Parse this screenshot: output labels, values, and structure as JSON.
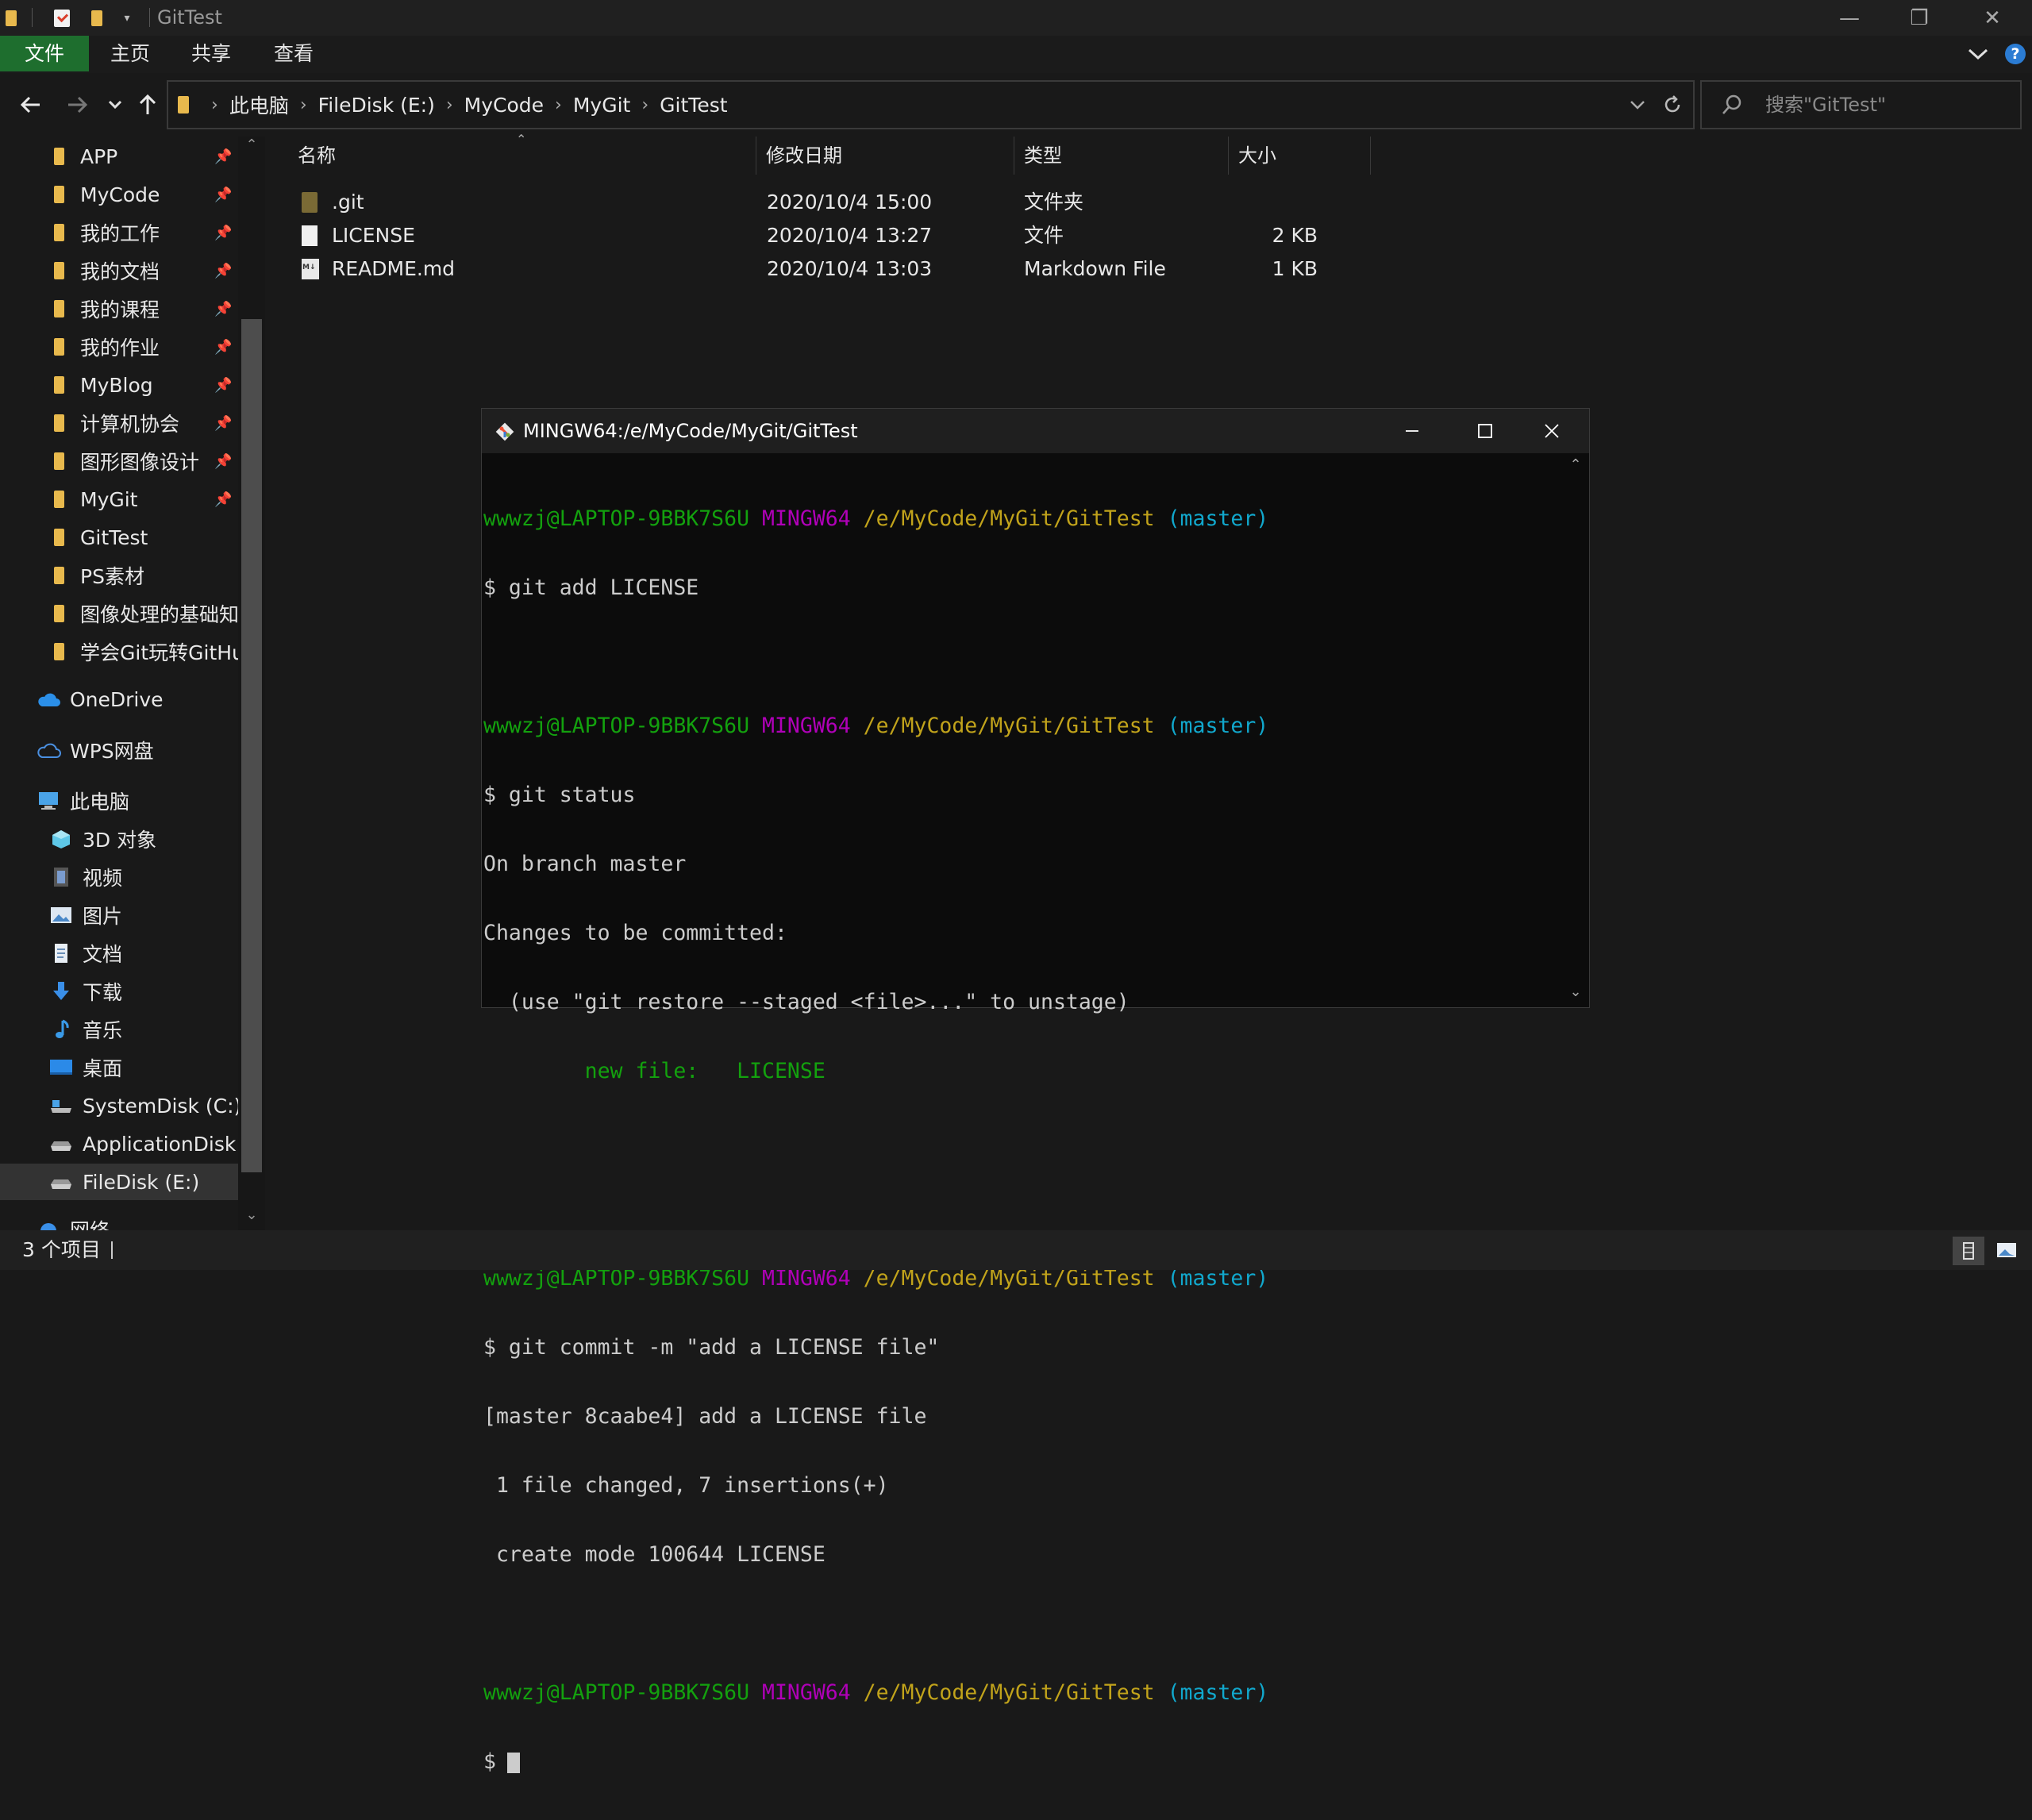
{
  "window": {
    "title": "GitTest",
    "controls": {
      "minimize": "—",
      "maximize": "❐",
      "close": "✕"
    }
  },
  "ribbon": {
    "tabs": [
      "文件",
      "主页",
      "共享",
      "查看"
    ],
    "help": "?"
  },
  "address": {
    "crumbs": [
      "此电脑",
      "FileDisk (E:)",
      "MyCode",
      "MyGit",
      "GitTest"
    ],
    "search_placeholder": "搜索\"GitTest\""
  },
  "nav": {
    "quick_access": [
      {
        "label": "APP",
        "pinned": true
      },
      {
        "label": "MyCode",
        "pinned": true
      },
      {
        "label": "我的工作",
        "pinned": true
      },
      {
        "label": "我的文档",
        "pinned": true
      },
      {
        "label": "我的课程",
        "pinned": true
      },
      {
        "label": "我的作业",
        "pinned": true
      },
      {
        "label": "MyBlog",
        "pinned": true
      },
      {
        "label": "计算机协会",
        "pinned": true
      },
      {
        "label": "图形图像设计",
        "pinned": true
      },
      {
        "label": "MyGit",
        "pinned": true
      },
      {
        "label": "GitTest",
        "pinned": false
      },
      {
        "label": "PS素材",
        "pinned": false
      },
      {
        "label": "图像处理的基础知识",
        "pinned": false
      },
      {
        "label": "学会Git玩转GitHub",
        "pinned": false
      }
    ],
    "onedrive": "OneDrive",
    "wps": "WPS网盘",
    "this_pc": "此电脑",
    "pc_items": [
      "3D 对象",
      "视频",
      "图片",
      "文档",
      "下载",
      "音乐",
      "桌面",
      "SystemDisk (C:)",
      "ApplicationDisk (D:)",
      "FileDisk (E:)"
    ],
    "network": "网络"
  },
  "list": {
    "headers": {
      "name": "名称",
      "date": "修改日期",
      "type": "类型",
      "size": "大小"
    },
    "rows": [
      {
        "name": ".git",
        "date": "2020/10/4 15:00",
        "type": "文件夹",
        "size": "",
        "icon": "folder-icon"
      },
      {
        "name": "LICENSE",
        "date": "2020/10/4 13:27",
        "type": "文件",
        "size": "2 KB",
        "icon": "file-icon"
      },
      {
        "name": "README.md",
        "date": "2020/10/4 13:03",
        "type": "Markdown File",
        "size": "1 KB",
        "icon": "markdown-file-icon"
      }
    ]
  },
  "status": {
    "item_count": "3 个项目"
  },
  "terminal": {
    "title": "MINGW64:/e/MyCode/MyGit/GitTest",
    "prompt": {
      "user": "wwwzj@LAPTOP-9BBK7S6U",
      "sys": "MINGW64",
      "path": "/e/MyCode/MyGit/GitTest",
      "branch": "(master)"
    },
    "commands": {
      "add": "$ git add LICENSE",
      "status": "$ git status",
      "commit": "$ git commit -m \"add a LICENSE file\"",
      "current": "$"
    },
    "output": {
      "status_line1": "On branch master",
      "status_line2": "Changes to be committed:",
      "status_line3": "  (use \"git restore --staged <file>...\" to unstage)",
      "status_new": "        new file:   LICENSE",
      "commit_line1": "[master 8caabe4] add a LICENSE file",
      "commit_line2": " 1 file changed, 7 insertions(+)",
      "commit_line3": " create mode 100644 LICENSE"
    }
  },
  "colors": {
    "accent_file_tab": "#1e6e2e",
    "term_green": "#13a10e",
    "term_magenta": "#b000b8",
    "term_yellow": "#c1a31b",
    "term_cyan": "#11a8cd"
  }
}
